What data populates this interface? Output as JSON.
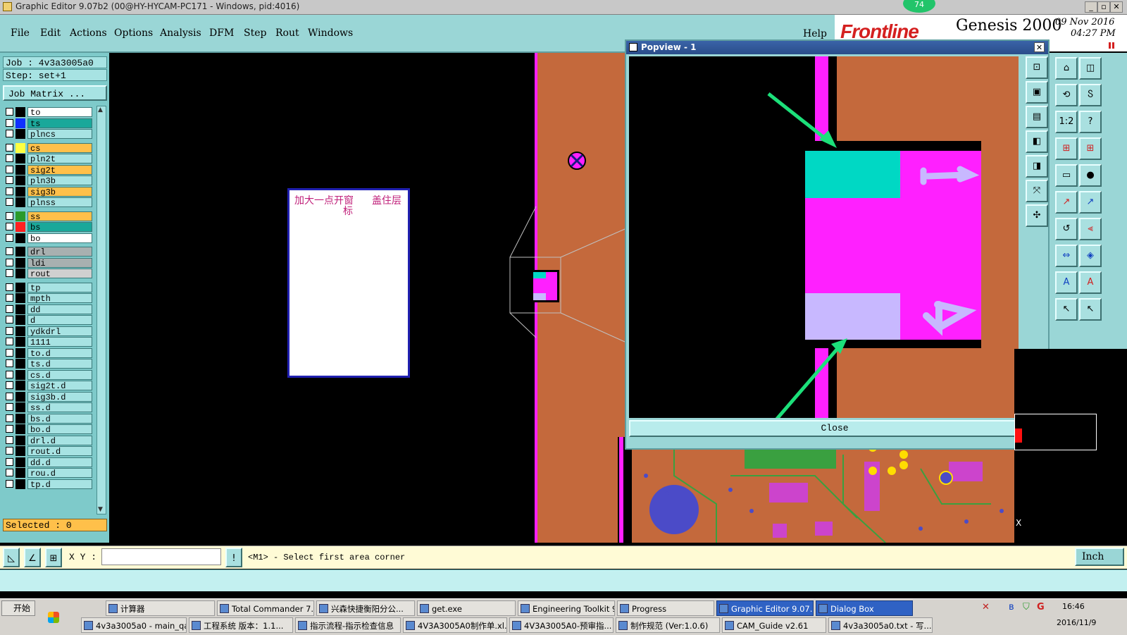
{
  "window": {
    "title": "Graphic Editor 9.07b2 (00@HY-HYCAM-PC171 - Windows, pid:4016)",
    "badge": "74",
    "buttons": [
      "_",
      "▫",
      "✕"
    ]
  },
  "menu": {
    "items": [
      "File",
      "Edit",
      "Actions",
      "Options",
      "Analysis",
      "DFM",
      "Step",
      "Rout",
      "Windows"
    ],
    "help": "Help"
  },
  "brand": {
    "logo": "Frontline",
    "product": "Genesis 2000",
    "date": "09 Nov 2016",
    "time": "04:27 PM"
  },
  "job": {
    "job_label": "Job : 4v3a3005a0",
    "step_label": "Step: set+1",
    "matrix_button": "Job Matrix ...",
    "selected": "Selected : 0"
  },
  "layers": [
    {
      "name": "to",
      "swatch": "#000000",
      "bg": "#ffffff"
    },
    {
      "name": "ts",
      "swatch": "#1030ff",
      "bg": "#1aa89a"
    },
    {
      "name": "plncs",
      "swatch": "#000000",
      "bg": "#a7e3e3"
    },
    {
      "name": "cs",
      "swatch": "#ffff40",
      "bg": "#ffc04a"
    },
    {
      "name": "pln2t",
      "swatch": "#000000",
      "bg": "#a7e3e3"
    },
    {
      "name": "sig2t",
      "swatch": "#000000",
      "bg": "#ffc04a"
    },
    {
      "name": "pln3b",
      "swatch": "#000000",
      "bg": "#a7e3e3"
    },
    {
      "name": "sig3b",
      "swatch": "#000000",
      "bg": "#ffc04a"
    },
    {
      "name": "plnss",
      "swatch": "#000000",
      "bg": "#a7e3e3"
    },
    {
      "name": "ss",
      "swatch": "#2a9a2a",
      "bg": "#ffc04a"
    },
    {
      "name": "bs",
      "swatch": "#ff2020",
      "bg": "#1aa89a"
    },
    {
      "name": "bo",
      "swatch": "#000000",
      "bg": "#ffffff"
    },
    {
      "name": "drl",
      "swatch": "#000000",
      "bg": "#a8b0b0"
    },
    {
      "name": "ldi",
      "swatch": "#000000",
      "bg": "#a8b0b0"
    },
    {
      "name": "rout",
      "swatch": "#000000",
      "bg": "#d0d0d0"
    },
    {
      "name": "tp",
      "swatch": "#000000",
      "bg": "#a7e3e3"
    },
    {
      "name": "mpth",
      "swatch": "#000000",
      "bg": "#a7e3e3"
    },
    {
      "name": "dd",
      "swatch": "#000000",
      "bg": "#a7e3e3"
    },
    {
      "name": "d",
      "swatch": "#000000",
      "bg": "#a7e3e3"
    },
    {
      "name": "ydkdrl",
      "swatch": "#000000",
      "bg": "#a7e3e3"
    },
    {
      "name": "1111",
      "swatch": "#000000",
      "bg": "#a7e3e3"
    },
    {
      "name": "to.d",
      "swatch": "#000000",
      "bg": "#a7e3e3"
    },
    {
      "name": "ts.d",
      "swatch": "#000000",
      "bg": "#a7e3e3"
    },
    {
      "name": "cs.d",
      "swatch": "#000000",
      "bg": "#a7e3e3"
    },
    {
      "name": "sig2t.d",
      "swatch": "#000000",
      "bg": "#a7e3e3"
    },
    {
      "name": "sig3b.d",
      "swatch": "#000000",
      "bg": "#a7e3e3"
    },
    {
      "name": "ss.d",
      "swatch": "#000000",
      "bg": "#a7e3e3"
    },
    {
      "name": "bs.d",
      "swatch": "#000000",
      "bg": "#a7e3e3"
    },
    {
      "name": "bo.d",
      "swatch": "#000000",
      "bg": "#a7e3e3"
    },
    {
      "name": "drl.d",
      "swatch": "#000000",
      "bg": "#a7e3e3"
    },
    {
      "name": "rout.d",
      "swatch": "#000000",
      "bg": "#a7e3e3"
    },
    {
      "name": "dd.d",
      "swatch": "#000000",
      "bg": "#a7e3e3"
    },
    {
      "name": "rou.d",
      "swatch": "#000000",
      "bg": "#a7e3e3"
    },
    {
      "name": "tp.d",
      "swatch": "#000000",
      "bg": "#a7e3e3"
    }
  ],
  "note": {
    "text1": "加大一点开窗",
    "text2": "盖住层",
    "text3": "标"
  },
  "popview": {
    "title": "Popview - 1",
    "close_label": "Close"
  },
  "tools": {
    "labels": [
      "1:2",
      "?"
    ]
  },
  "side": {
    "x_label": "X"
  },
  "command": {
    "xy_label": "X Y :",
    "xy_value": "",
    "bang": "!",
    "prompt": "<M1> - Select first area corner",
    "units": "Inch"
  },
  "taskbar": {
    "start": "开始",
    "row1": [
      "计算器",
      "Total Commander 7.0...",
      "兴森快捷衡阳分公...",
      "get.exe",
      "Engineering Toolkit 9....",
      "Progress",
      "Graphic Editor 9.07...",
      "Dialog Box"
    ],
    "row2": [
      "4v3a3005a0 - main_qa",
      "工程系统  版本：1.1...",
      "指示流程-指示检查信息",
      "4V3A3005A0制作单.xl...",
      "4V3A3005A0-预审指...",
      "制作规范 (Ver:1.0.6)",
      "CAM_Guide v2.61",
      "4v3a3005a0.txt - 写..."
    ],
    "clock_time": "16:46",
    "clock_date": "2016/11/9"
  }
}
